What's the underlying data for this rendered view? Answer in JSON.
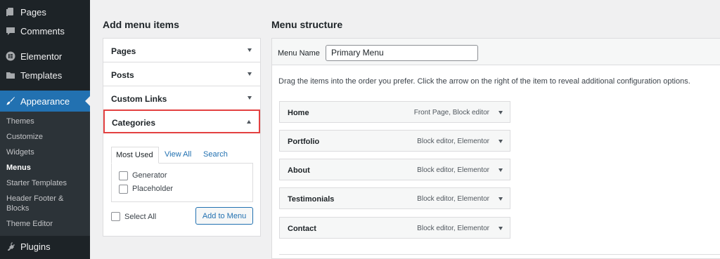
{
  "sidebar": {
    "top_items": [
      {
        "label": "Pages",
        "icon": "pages-icon"
      },
      {
        "label": "Comments",
        "icon": "comments-icon"
      },
      {
        "label": "Elementor",
        "icon": "elementor-icon"
      },
      {
        "label": "Templates",
        "icon": "folder-icon"
      }
    ],
    "appearance": {
      "label": "Appearance",
      "icon": "brush-icon"
    },
    "submenu": [
      {
        "label": "Themes"
      },
      {
        "label": "Customize"
      },
      {
        "label": "Widgets"
      },
      {
        "label": "Menus",
        "active": true
      },
      {
        "label": "Starter Templates"
      },
      {
        "label": "Header Footer &"
      },
      {
        "label": "Blocks"
      },
      {
        "label": "Theme Editor"
      }
    ],
    "plugins": {
      "label": "Plugins",
      "icon": "plugin-icon"
    }
  },
  "add_menu_items": {
    "heading": "Add menu items",
    "sections": [
      {
        "label": "Pages"
      },
      {
        "label": "Posts"
      },
      {
        "label": "Custom Links"
      }
    ],
    "categories": {
      "label": "Categories",
      "tabs": [
        "Most Used",
        "View All",
        "Search"
      ],
      "items": [
        "Generator",
        "Placeholder"
      ],
      "select_all": "Select All",
      "add_button": "Add to Menu"
    }
  },
  "menu_structure": {
    "heading": "Menu structure",
    "menu_name_label": "Menu Name",
    "menu_name_value": "Primary Menu",
    "instructions": "Drag the items into the order you prefer. Click the arrow on the right of the item to reveal additional configuration options.",
    "items": [
      {
        "name": "Home",
        "meta": "Front Page, Block editor"
      },
      {
        "name": "Portfolio",
        "meta": "Block editor, Elementor"
      },
      {
        "name": "About",
        "meta": "Block editor, Elementor"
      },
      {
        "name": "Testimonials",
        "meta": "Block editor, Elementor"
      },
      {
        "name": "Contact",
        "meta": "Block editor, Elementor"
      }
    ]
  },
  "colors": {
    "accent": "#2271b1",
    "highlight_border": "#e34141",
    "sidebar_bg": "#1d2327"
  }
}
